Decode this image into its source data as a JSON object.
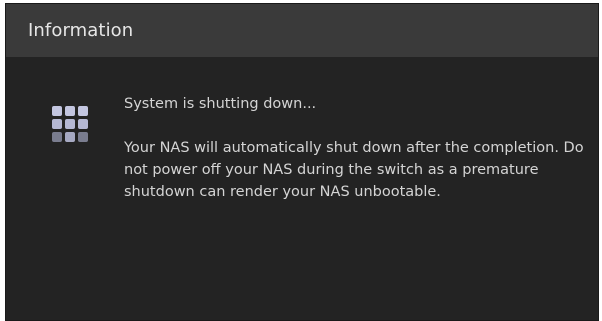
{
  "dialog": {
    "title": "Information",
    "status": "System is shutting down...",
    "message": "Your NAS will automatically shut down after the completion. Do not power off your NAS during the switch as a premature shutdown can render your NAS unbootable.",
    "icon": "app-grid-icon"
  },
  "colors": {
    "titlebar": "#3a3a3a",
    "background": "#232323",
    "text": "#d4d4d4",
    "icon": "#b9bcd6"
  }
}
